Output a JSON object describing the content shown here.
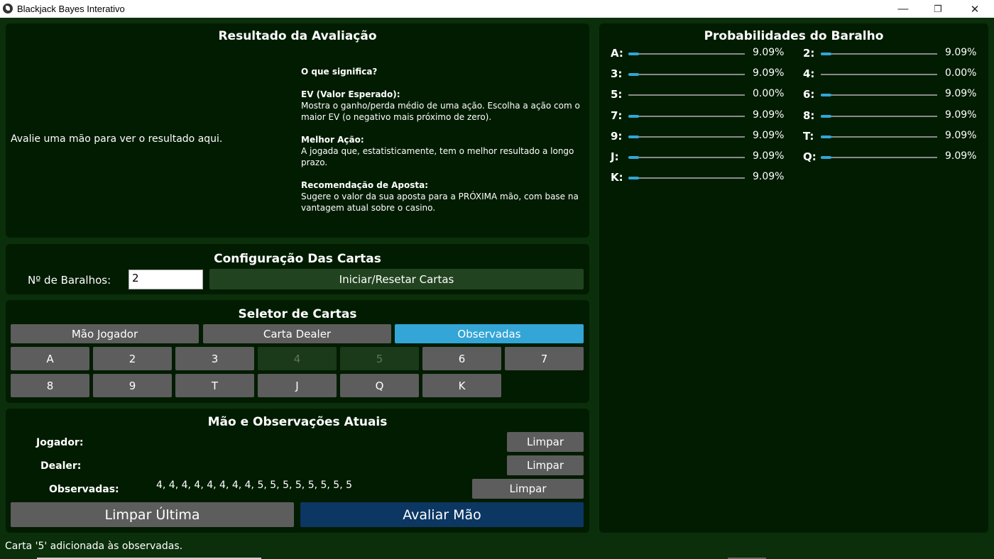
{
  "window": {
    "title": "Blackjack Bayes Interativo",
    "minimize": "—",
    "restore": "❐",
    "close": "✕"
  },
  "result": {
    "title": "Resultado da Avaliação",
    "placeholder": "Avalie uma mão para ver o resultado aqui.",
    "help_title": "O que significa?",
    "ev_title": "EV (Valor Esperado):",
    "ev_text": "Mostra o ganho/perda médio de uma ação. Escolha a ação com o maior EV (o negativo mais próximo de zero).",
    "best_title": "Melhor Ação:",
    "best_text": "A jogada que, estatisticamente, tem o melhor resultado a longo prazo.",
    "bet_title": "Recomendação de Aposta:",
    "bet_text": "Sugere o valor da sua aposta para a PRÓXIMA mão, com base na vantagem atual sobre o casino."
  },
  "config": {
    "title": "Configuração Das Cartas",
    "decks_label": "Nº de Baralhos:",
    "decks_value": "2",
    "reset_button": "Iniciar/Resetar Cartas"
  },
  "selector": {
    "title": "Seletor de Cartas",
    "tabs": [
      "Mão Jogador",
      "Carta Dealer",
      "Observadas"
    ],
    "cards_row1": [
      "A",
      "2",
      "3",
      "4",
      "5",
      "6",
      "7"
    ],
    "cards_row2": [
      "8",
      "9",
      "T",
      "J",
      "Q",
      "K"
    ]
  },
  "hand": {
    "title": "Mão e Observações Atuais",
    "player_label": "Jogador:",
    "dealer_label": "Dealer:",
    "observed_label": "Observadas:",
    "observed_value": "4, 4, 4, 4, 4, 4, 4, 4, 5, 5, 5, 5, 5, 5, 5, 5",
    "clear_label": "Limpar",
    "undo_button": "Limpar Última",
    "evaluate_button": "Avaliar Mão"
  },
  "probabilities": {
    "title": "Probabilidades do Baralho",
    "items": [
      {
        "card": "A:",
        "value": "9.09%",
        "level": 0.0909
      },
      {
        "card": "2:",
        "value": "9.09%",
        "level": 0.0909
      },
      {
        "card": "3:",
        "value": "9.09%",
        "level": 0.0909
      },
      {
        "card": "4:",
        "value": "0.00%",
        "level": 0
      },
      {
        "card": "5:",
        "value": "0.00%",
        "level": 0
      },
      {
        "card": "6:",
        "value": "9.09%",
        "level": 0.0909
      },
      {
        "card": "7:",
        "value": "9.09%",
        "level": 0.0909
      },
      {
        "card": "8:",
        "value": "9.09%",
        "level": 0.0909
      },
      {
        "card": "9:",
        "value": "9.09%",
        "level": 0.0909
      },
      {
        "card": "T:",
        "value": "9.09%",
        "level": 0.0909
      },
      {
        "card": "J:",
        "value": "9.09%",
        "level": 0.0909
      },
      {
        "card": "Q:",
        "value": "9.09%",
        "level": 0.0909
      },
      {
        "card": "K:",
        "value": "9.09%",
        "level": 0.0909
      }
    ]
  },
  "status": "Carta '5' adicionada às observadas.",
  "colors": {
    "background": "#0b2f0b",
    "panel": "#021c02",
    "accent": "#33a5d6",
    "primary": "#0c3763",
    "button": "#5d5d5d"
  }
}
